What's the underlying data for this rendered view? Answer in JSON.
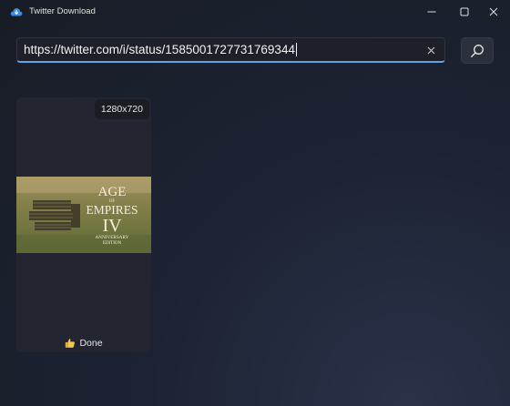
{
  "window": {
    "title": "Twitter Download"
  },
  "search": {
    "value": "https://twitter.com/i/status/1585001727731769344"
  },
  "results": [
    {
      "resolution": "1280x720",
      "thumbnail_lines": [
        "AGE",
        "OF",
        "EMPIRES",
        "IV",
        "ANNIVERSARY",
        "EDITION"
      ],
      "status_icon": "thumbs-up-icon",
      "status": "Done"
    }
  ],
  "colors": {
    "accent": "#5da4e8",
    "background": "#1d2333"
  }
}
